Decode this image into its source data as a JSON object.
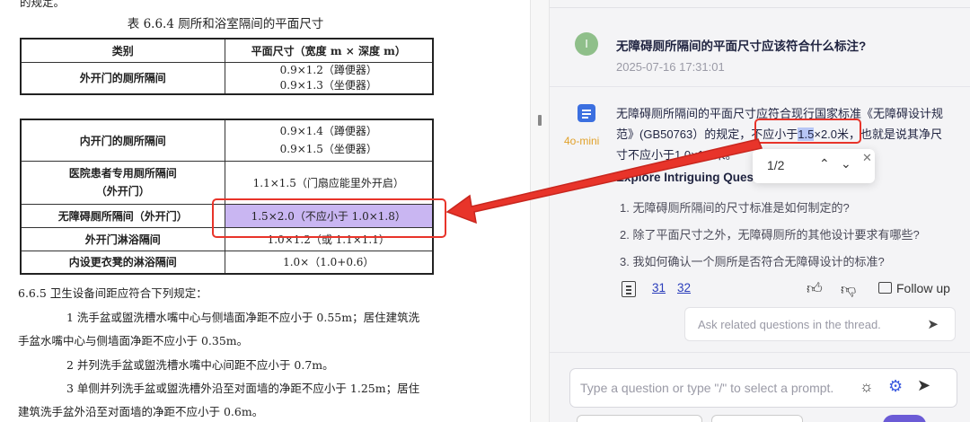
{
  "document": {
    "top_fragment": "的规定。",
    "caption": "表 6.6.4  厕所和浴室隔间的平面尺寸",
    "table_header": {
      "col1": "类别",
      "col2": "平面尺寸（宽度 m × 深度 m）"
    },
    "rows_page1": [
      {
        "category": "外开门的厕所隔间",
        "size_lines": [
          "0.9×1.2（蹲便器）",
          "0.9×1.3（坐便器）"
        ]
      }
    ],
    "rows_page2": [
      {
        "category": "内开门的厕所隔间",
        "size_lines": [
          "0.9×1.4（蹲便器）",
          "0.9×1.5（坐便器）"
        ]
      },
      {
        "category_lines": [
          "医院患者专用厕所隔间",
          "（外开门）"
        ],
        "size": "1.1×1.5（门扇应能里外开启）"
      },
      {
        "category": "无障碍厕所隔间（外开门）",
        "size": "1.5×2.0（不应小于 1.0×1.8）",
        "highlighted": true
      },
      {
        "category": "外开门淋浴隔间",
        "size": "1.0×1.2（或 1.1×1.1）"
      },
      {
        "category": "内设更衣凳的淋浴隔间",
        "size": "1.0×（1.0+0.6）"
      }
    ],
    "paragraphs": [
      "6.6.5  卫生设备间距应符合下列规定：",
      "1  洗手盆或盥洗槽水嘴中心与侧墙面净距不应小于 0.55m；居住建筑洗",
      "手盆水嘴中心与侧墙面净距不应小于 0.35m。",
      "2  并列洗手盆或盥洗槽水嘴中心间距不应小于 0.7m。",
      "3  单侧并列洗手盆或盥洗槽外沿至对面墙的净距不应小于 1.25m；居住",
      "建筑洗手盆外沿至对面墙的净距不应小于 0.6m。"
    ],
    "highlight_color": "#c9b6f2",
    "annotation_color": "#e8342a"
  },
  "chat": {
    "user": {
      "avatar_letter": "I",
      "question": "无障碍厕所隔间的平面尺寸应该符合什么标注?",
      "timestamp": "2025-07-16 17:31:01"
    },
    "assistant": {
      "model": "4o-mini",
      "answer_line1": "无障碍厕所隔间的平面尺寸应符合现行国家标准《无障碍设计规",
      "answer_line2_a": "范》(GB50763）的规定，",
      "answer_boxed_a": "不应小于",
      "answer_boxed_mark": "1.5",
      "answer_boxed_b": "×2.0米",
      "answer_line2_b": "，也就是说其净尺",
      "answer_line3": "寸不应小于1.0×1.8米。",
      "find_count": "1/2",
      "explore_title": "Explore Intriguing Questions",
      "related_questions": [
        "1. 无障碍厕所隔间的尺寸标准是如何制定的?",
        "2. 除了平面尺寸之外，无障碍厕所的其他设计要求有哪些?",
        "3. 我如何确认一个厕所是否符合无障碍设计的标准?"
      ],
      "sources": [
        "31",
        "32"
      ],
      "follow_up_label": "Follow up",
      "related_placeholder": "Ask related questions in the thread."
    },
    "prompt_placeholder": "Type a question or type \"/\" to select a prompt.",
    "accent": "#3b5be0",
    "model_color": "#e1a12a"
  }
}
